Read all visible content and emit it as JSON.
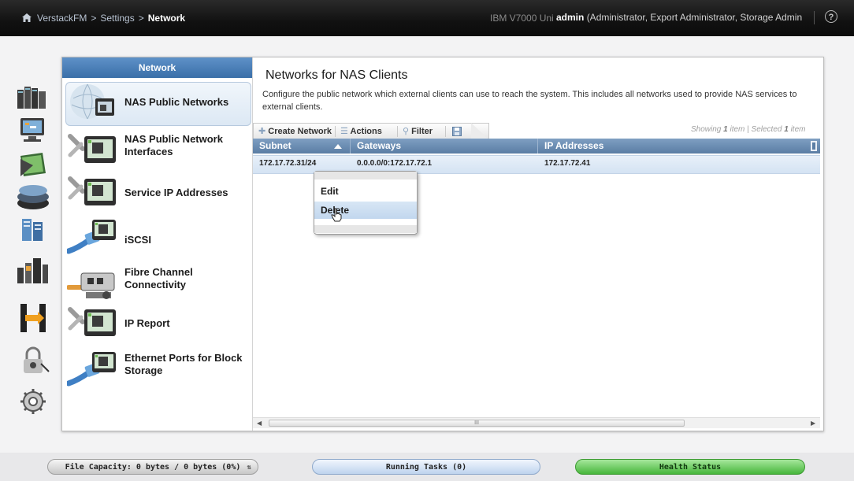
{
  "topbar": {
    "breadcrumb": [
      "VerstackFM",
      "Settings",
      "Network"
    ],
    "separator": ">",
    "system_name": "IBM V7000 Uni",
    "user": "admin",
    "roles": "(Administrator, Export Administrator, Storage Administrator, System Admin...",
    "help_glyph": "?"
  },
  "leftnav": {
    "icons": [
      "overview-icon",
      "monitoring-icon",
      "pools-icon",
      "volumes-icon",
      "hosts-icon",
      "copy-services-icon",
      "access-icon",
      "migration-icon",
      "security-icon",
      "settings-icon"
    ]
  },
  "menu": {
    "header": "Network",
    "items": [
      {
        "label": "NAS Public Networks",
        "icon": "nas-network-icon",
        "selected": true
      },
      {
        "label": "NAS Public Network Interfaces",
        "icon": "nas-interfaces-icon"
      },
      {
        "label": "Service IP Addresses",
        "icon": "service-ip-icon"
      },
      {
        "label": "iSCSI",
        "icon": "iscsi-cable-icon"
      },
      {
        "label": "Fibre Channel Connectivity",
        "icon": "fibre-channel-icon"
      },
      {
        "label": "IP Report",
        "icon": "ip-report-icon"
      },
      {
        "label": "Ethernet Ports for Block Storage",
        "icon": "ethernet-port-icon"
      }
    ]
  },
  "content": {
    "title": "Networks for NAS Clients",
    "description": "Configure the public network which external clients can use to reach the system. This includes all networks used to provide NAS services to external clients."
  },
  "toolbar": {
    "create": "Create Network",
    "actions": "Actions",
    "filter": "Filter",
    "showing_prefix": "Showing",
    "showing_count": "1",
    "showing_mid": "item | Selected",
    "selected_count": "1",
    "showing_suffix": "item"
  },
  "grid": {
    "columns": [
      "Subnet",
      "Gateways",
      "IP Addresses"
    ],
    "rows": [
      {
        "subnet": "172.17.72.31/24",
        "gateways": "0.0.0.0/0:172.17.72.1",
        "ip_addresses": "172.17.72.41"
      }
    ],
    "scroll_glyph": "III"
  },
  "context_menu": {
    "items": [
      "Edit",
      "Delete"
    ],
    "hovered": "Delete"
  },
  "statusbar": {
    "file_capacity": "File Capacity: 0 bytes / 0 bytes (0%)",
    "running_tasks": "Running Tasks (0)",
    "health_status": "Health Status",
    "colors": {
      "health": "#47b63c",
      "tasks": "#bed3ee"
    }
  }
}
